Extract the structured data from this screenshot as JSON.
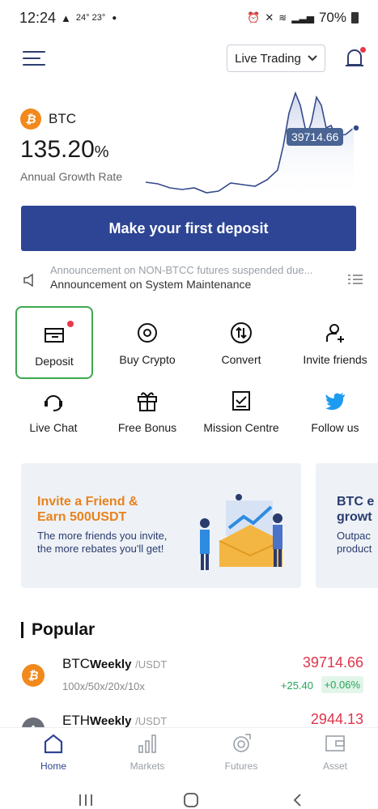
{
  "status_bar": {
    "time": "12:24",
    "weather": "24° 23°",
    "battery": "70%"
  },
  "header": {
    "mode_select": "Live Trading",
    "has_notification": true
  },
  "hero": {
    "symbol": "BTC",
    "rate_value": "135.20",
    "rate_unit": "%",
    "rate_label": "Annual Growth Rate",
    "price_tag": "39714.66",
    "coin_color": "#f2891c"
  },
  "cta": {
    "label": "Make your first deposit",
    "color": "#2e4595"
  },
  "announcement": {
    "faded_text": "Announcement on NON-BTCC futures suspended due...",
    "text": "Announcement on System Maintenance"
  },
  "actions": [
    {
      "label": "Deposit",
      "icon": "deposit-icon",
      "selected": true,
      "badge": true
    },
    {
      "label": "Buy Crypto",
      "icon": "buy-crypto-icon"
    },
    {
      "label": "Convert",
      "icon": "convert-icon"
    },
    {
      "label": "Invite friends",
      "icon": "invite-icon"
    },
    {
      "label": "Live Chat",
      "icon": "chat-icon"
    },
    {
      "label": "Free Bonus",
      "icon": "gift-icon"
    },
    {
      "label": "Mission Centre",
      "icon": "mission-icon"
    },
    {
      "label": "Follow us",
      "icon": "twitter-icon"
    }
  ],
  "banners": [
    {
      "title_line1": "Invite a Friend &",
      "title_line2": "Earn 500USDT",
      "sub_line1": "The more friends you invite,",
      "sub_line2": "the more rebates you'll get!"
    },
    {
      "title_line1": "BTC e",
      "title_line2": "growt",
      "sub_line1": "Outpac",
      "sub_line2": "product"
    }
  ],
  "popular": {
    "title": "Popular",
    "rows": [
      {
        "base": "BTC",
        "freq": "Weekly",
        "quote": "/USDT",
        "leverage": "100x/50x/20x/10x",
        "price": "39714.66",
        "change": "+25.40",
        "change_pct": "+0.06%",
        "coin_color": "#f2891c",
        "coin_symbol": "₿"
      },
      {
        "base": "ETH",
        "freq": "Weekly",
        "quote": "/USDT",
        "price": "2944.13",
        "coin_color": "#6b6f78",
        "coin_symbol": "◆"
      }
    ]
  },
  "bottom_nav": [
    {
      "label": "Home",
      "icon": "home-icon",
      "active": true
    },
    {
      "label": "Markets",
      "icon": "markets-icon"
    },
    {
      "label": "Futures",
      "icon": "futures-icon"
    },
    {
      "label": "Asset",
      "icon": "asset-icon"
    }
  ]
}
